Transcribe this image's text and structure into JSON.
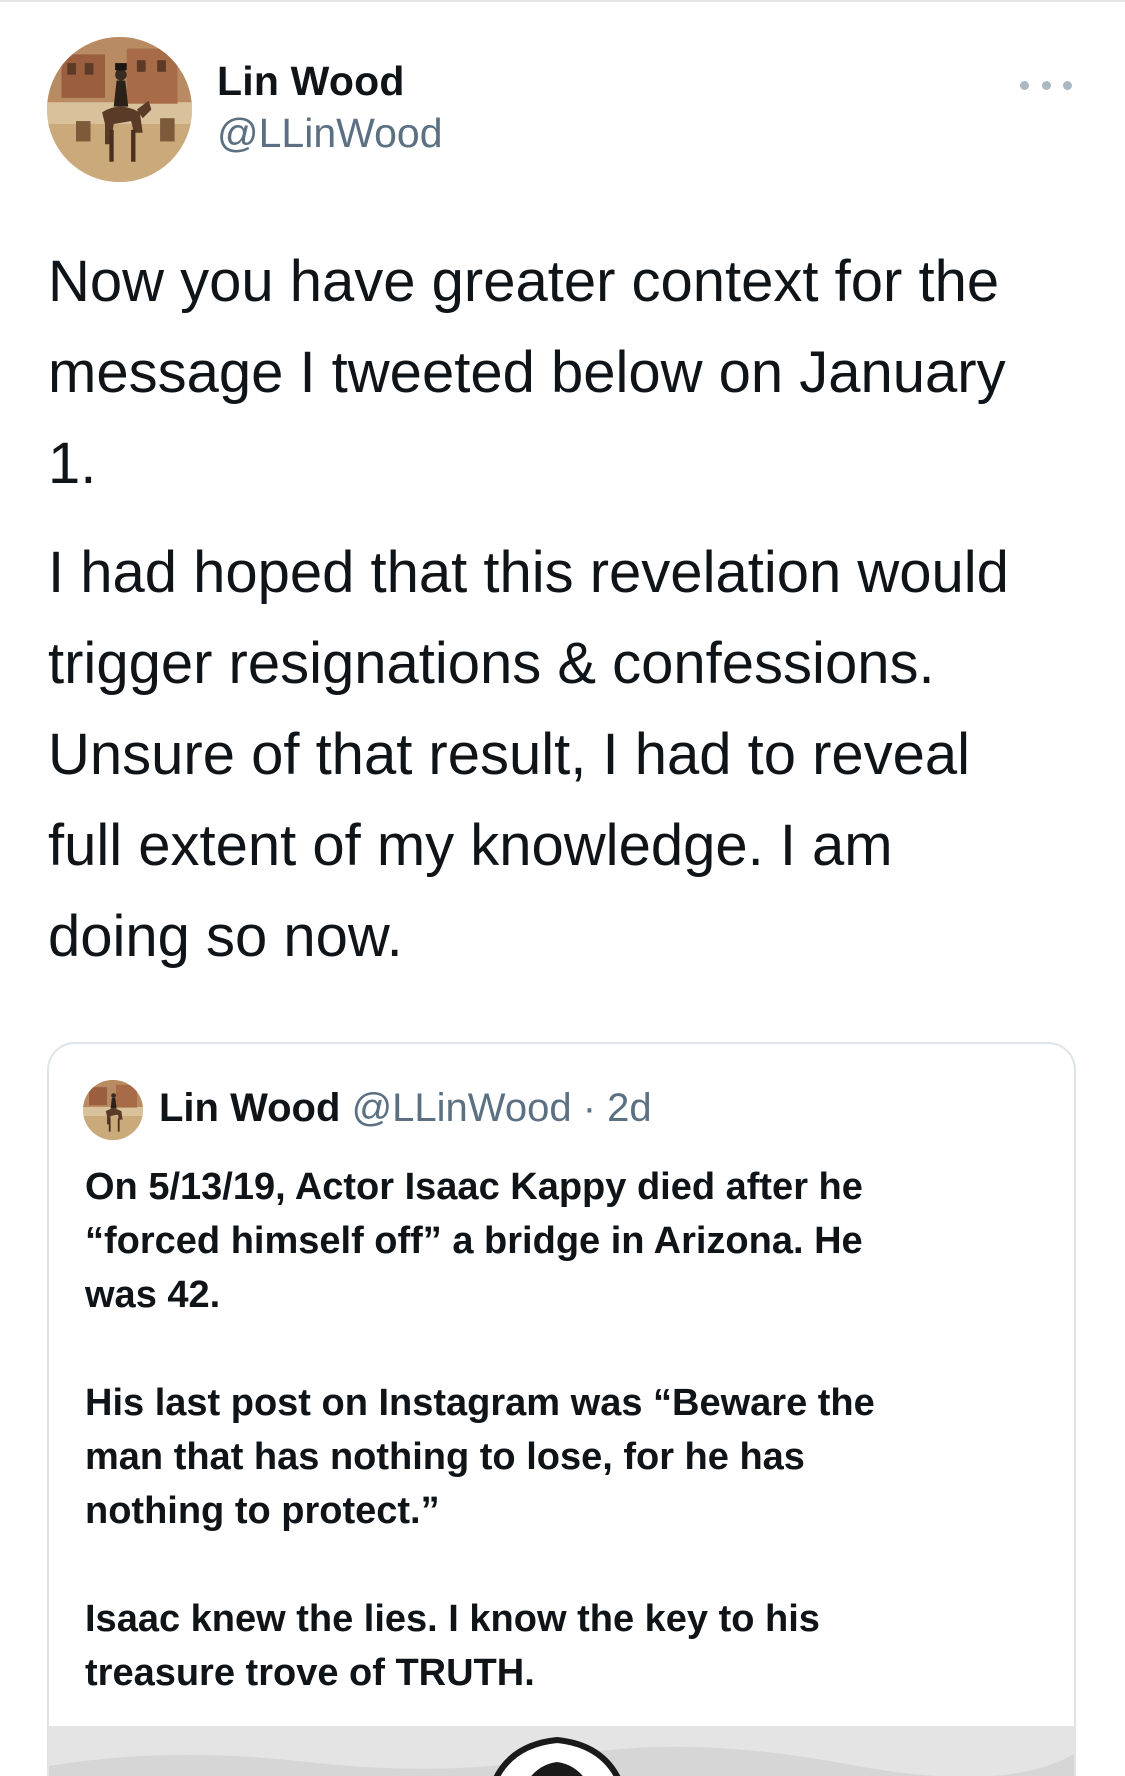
{
  "tweet": {
    "author": {
      "name": "Lin Wood",
      "handle": "@LLinWood"
    },
    "paragraphs": [
      "Now you have greater context for the\nmessage I tweeted below on January\n1.",
      "I had hoped that this revelation would\ntrigger resignations & confessions.\nUnsure of that result, I had to reveal\nfull extent of my knowledge. I am\ndoing so now."
    ],
    "more_icon": "more-horizontal-icon"
  },
  "quoted_tweet": {
    "author": {
      "name": "Lin Wood",
      "handle": "@LLinWood",
      "separator": "·",
      "time": "2d"
    },
    "paragraphs": [
      "On 5/13/19, Actor Isaac Kappy died after he\n“forced himself off” a bridge in Arizona. He\nwas 42.",
      "His last post on Instagram was “Beware the\nman that has nothing to lose, for he has\nnothing to protect.”",
      "Isaac knew the lies. I know the key to his\ntreasure trove of TRUTH."
    ]
  },
  "colors": {
    "text_primary": "#0f1419",
    "text_secondary": "#5b7083",
    "border": "#dfe4e8"
  }
}
